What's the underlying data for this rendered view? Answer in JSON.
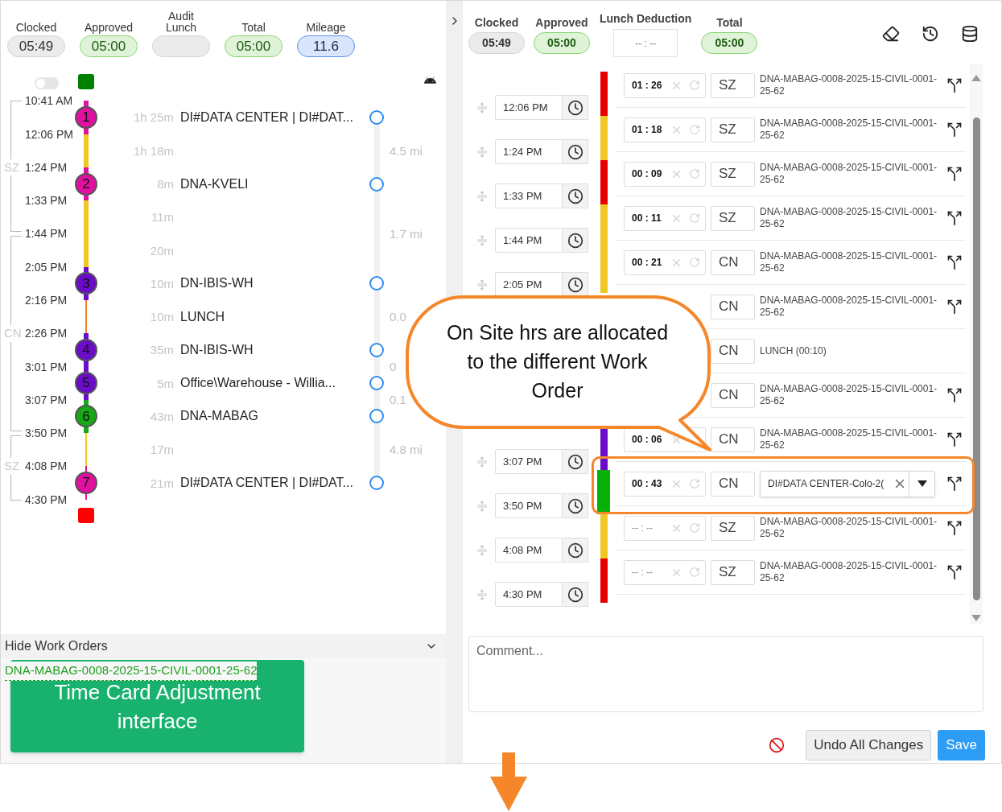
{
  "left": {
    "summary": [
      {
        "label": "Clocked",
        "value": "05:49",
        "kind": "gray"
      },
      {
        "label": "Approved",
        "value": "05:00",
        "kind": "green"
      },
      {
        "label": "Audit Lunch",
        "kind": "gray"
      },
      {
        "label": "Total",
        "value": "05:00",
        "kind": "green"
      },
      {
        "label": "Mileage",
        "value": "11.6",
        "kind": "blue"
      }
    ],
    "timeline": {
      "toggle_on": false,
      "times": [
        {
          "time": "10:41 AM",
          "kind": "top"
        },
        {
          "time": "12:06 PM",
          "kind": "side"
        },
        {
          "time": "1:24 PM",
          "kind": "label",
          "zone": "SZ"
        },
        {
          "time": "1:33 PM",
          "kind": "side"
        },
        {
          "time": "1:44 PM",
          "kind": "join",
          "mileage": "1.7 mi"
        },
        {
          "time": "2:05 PM",
          "kind": "side"
        },
        {
          "time": "2:16 PM",
          "kind": "side"
        },
        {
          "time": "2:26 PM",
          "kind": "label",
          "zone": "CN"
        },
        {
          "time": "3:01 PM",
          "kind": "side",
          "mileage": "0"
        },
        {
          "time": "3:07 PM",
          "kind": "side",
          "mileage": "0.1"
        },
        {
          "time": "3:50 PM",
          "kind": "join"
        },
        {
          "time": "4:08 PM",
          "kind": "label",
          "zone": "SZ"
        },
        {
          "time": "4:30 PM",
          "kind": "bottom"
        }
      ],
      "segments": [
        {
          "duration": "1h 25m",
          "name": "DI#DATA CENTER | DI#DAT...",
          "stop": "1",
          "color": "#e010a0",
          "kind": "thick",
          "selected": false
        },
        {
          "duration": "1h 18m",
          "color": "#f0c823",
          "kind": "thick",
          "mileage": "4.5 mi"
        },
        {
          "duration": "8m",
          "name": "DNA-KVELI",
          "stop": "2",
          "color": "#e010a0",
          "kind": "thick",
          "selected": false
        },
        {
          "duration": "11m",
          "color": "#f0c823",
          "kind": "thick"
        },
        {
          "duration": "20m",
          "color": "#f0c823",
          "kind": "thick"
        },
        {
          "duration": "10m",
          "name": "DN-IBIS-WH",
          "stop": "3",
          "color": "#6a0cc8",
          "kind": "thick",
          "selected": false
        },
        {
          "duration": "10m",
          "name": "LUNCH",
          "color": "#f5821f",
          "kind": "thin",
          "mileage": "0.0"
        },
        {
          "duration": "35m",
          "name": "DN-IBIS-WH",
          "stop": "4",
          "color": "#6a0cc8",
          "kind": "thick",
          "selected": false
        },
        {
          "duration": "5m",
          "name": "Office\\Warehouse - Willia...",
          "stop": "5",
          "color": "#6a0cc8",
          "kind": "thick",
          "selected": false
        },
        {
          "duration": "43m",
          "name": "DNA-MABAG",
          "stop": "6",
          "color": "#16a816",
          "kind": "thick",
          "selected": false
        },
        {
          "duration": "17m",
          "color": "#f0c823",
          "kind": "thin",
          "mileage": "4.8 mi"
        },
        {
          "duration": "21m",
          "name": "DI#DATA CENTER | DI#DAT...",
          "stop": "7",
          "color": "#e010a0",
          "kind": "thin",
          "selected": false
        }
      ]
    },
    "work_orders": {
      "toggle": "Hide Work Orders",
      "links": [
        "DNA-MABAG-0008-2025-15-CIVIL-0001-25-62"
      ]
    }
  },
  "right": {
    "summary": [
      {
        "label": "Clocked",
        "value": "05:49",
        "kind": "gray"
      },
      {
        "label": "Approved",
        "value": "05:00",
        "kind": "green"
      },
      {
        "label": "Lunch Deduction",
        "placeholder": "-- : --",
        "kind": "field"
      },
      {
        "label": "Total",
        "value": "05:00",
        "kind": "green"
      }
    ],
    "times": [
      {
        "kind": "time",
        "value": "12:06 PM"
      },
      {
        "kind": "time",
        "value": "1:24 PM"
      },
      {
        "kind": "time",
        "value": "1:33 PM"
      },
      {
        "kind": "time",
        "value": "1:44 PM"
      },
      {
        "kind": "time",
        "value": "2:05 PM"
      },
      {
        "kind": "covered"
      },
      {
        "kind": "covered"
      },
      {
        "kind": "covered"
      },
      {
        "kind": "time",
        "value": "3:07 PM"
      },
      {
        "kind": "time",
        "value": "3:50 PM"
      },
      {
        "kind": "time",
        "value": "4:08 PM"
      },
      {
        "kind": "time",
        "value": "4:30 PM"
      }
    ],
    "rows": [
      {
        "duration": "01 : 26",
        "code": "SZ",
        "kind": "order",
        "order": "DNA-MABAG-0008-2025-15-CIVIL-0001-25-62",
        "color": "#e60000"
      },
      {
        "duration": "01 : 18",
        "code": "SZ",
        "kind": "order",
        "order": "DNA-MABAG-0008-2025-15-CIVIL-0001-25-62",
        "color": "#f0c823"
      },
      {
        "duration": "00 : 09",
        "code": "SZ",
        "kind": "order",
        "order": "DNA-MABAG-0008-2025-15-CIVIL-0001-25-62",
        "color": "#e60000"
      },
      {
        "duration": "00 : 11",
        "code": "SZ",
        "kind": "order",
        "order": "DNA-MABAG-0008-2025-15-CIVIL-0001-25-62",
        "color": "#f0c823"
      },
      {
        "duration": "00 : 21",
        "code": "CN",
        "kind": "order",
        "order": "DNA-MABAG-0008-2025-15-CIVIL-0001-25-62",
        "color": "#f0c823"
      },
      {
        "code": "CN",
        "kind": "order",
        "order": "DNA-MABAG-0008-2025-15-CIVIL-0001-25-62"
      },
      {
        "code": "CN",
        "kind": "lunch",
        "order": "LUNCH (00:10)"
      },
      {
        "code": "CN",
        "kind": "order",
        "order": "DNA-MABAG-0008-2025-15-CIVIL-0001-25-62"
      },
      {
        "duration": "00 : 06",
        "code": "CN",
        "kind": "order",
        "order": "DNA-MABAG-0008-2025-15-CIVIL-0001-25-62",
        "color": "#6a0cc8"
      },
      {
        "duration": "00 : 43",
        "code": "CN",
        "kind": "picker",
        "order": "DI#DATA CENTER-Colo-2(",
        "color": "#08b008"
      },
      {
        "placeholder": "-- : --",
        "code": "SZ",
        "kind": "order",
        "order": "DNA-MABAG-0008-2025-15-CIVIL-0001-25-62",
        "color": "#f0c823"
      },
      {
        "placeholder": "-- : --",
        "code": "SZ",
        "kind": "order",
        "order": "DNA-MABAG-0008-2025-15-CIVIL-0001-25-62",
        "color": "#e60000"
      }
    ],
    "comment": {
      "placeholder": "Comment..."
    },
    "buttons": [
      {
        "label": "Undo All Changes",
        "kind": "secondary"
      },
      {
        "label": "Save",
        "kind": "primary"
      }
    ]
  },
  "annotations": {
    "callout": "On Site hrs are allocated to the different Work Order",
    "label": "Time Card Adjustment interface"
  }
}
